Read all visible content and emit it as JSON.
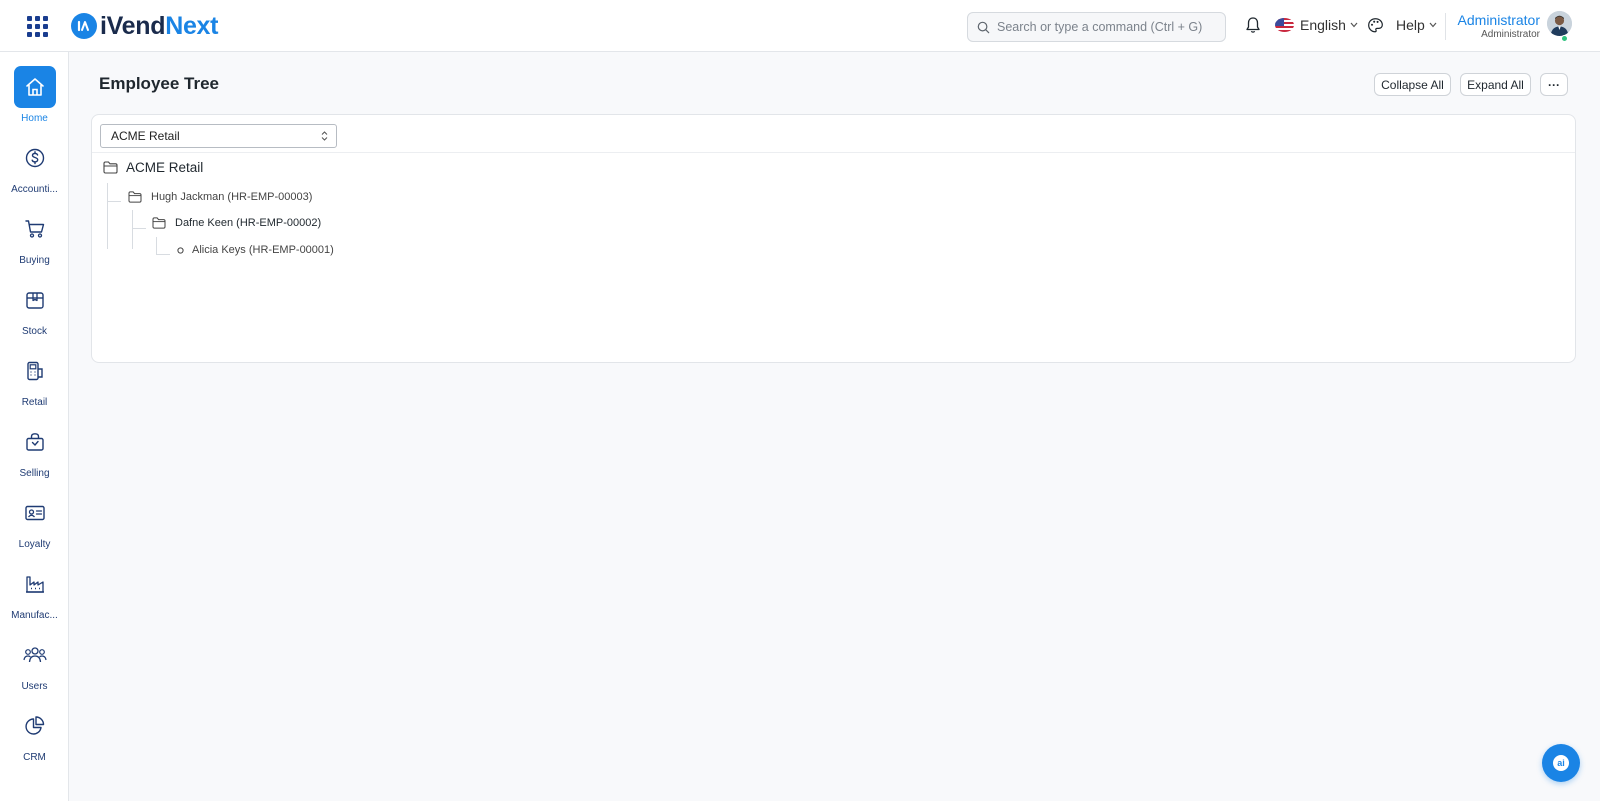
{
  "app": {
    "logo_part1": "iVend",
    "logo_part2": "Next"
  },
  "header": {
    "search_placeholder": "Search or type a command (Ctrl + G)",
    "language": "English",
    "help": "Help",
    "user_name": "Administrator",
    "user_role": "Administrator"
  },
  "sidebar": {
    "items": [
      {
        "label": "Home",
        "icon": "home-icon",
        "active": true
      },
      {
        "label": "Accounti...",
        "icon": "dollar-circle-icon"
      },
      {
        "label": "Buying",
        "icon": "cart-icon"
      },
      {
        "label": "Stock",
        "icon": "box-icon"
      },
      {
        "label": "Retail",
        "icon": "pos-terminal-icon"
      },
      {
        "label": "Selling",
        "icon": "shopping-bag-icon"
      },
      {
        "label": "Loyalty",
        "icon": "id-card-icon"
      },
      {
        "label": "Manufac...",
        "icon": "factory-icon"
      },
      {
        "label": "Users",
        "icon": "users-icon"
      },
      {
        "label": "CRM",
        "icon": "pie-chart-icon"
      }
    ]
  },
  "page": {
    "title": "Employee Tree",
    "collapse_all": "Collapse All",
    "expand_all": "Expand All",
    "more": "···"
  },
  "tree": {
    "company_select": "ACME Retail",
    "nodes": [
      {
        "label": "ACME Retail",
        "level": 0,
        "type": "folder"
      },
      {
        "label": "Hugh Jackman (HR-EMP-00003)",
        "level": 1,
        "type": "folder"
      },
      {
        "label": "Dafne Keen (HR-EMP-00002)",
        "level": 2,
        "type": "folder"
      },
      {
        "label": "Alicia Keys (HR-EMP-00001)",
        "level": 3,
        "type": "leaf"
      }
    ]
  },
  "assistant": {
    "label": "ai"
  },
  "colors": {
    "accent": "#1a84e5",
    "navy": "#1a2b4c"
  }
}
